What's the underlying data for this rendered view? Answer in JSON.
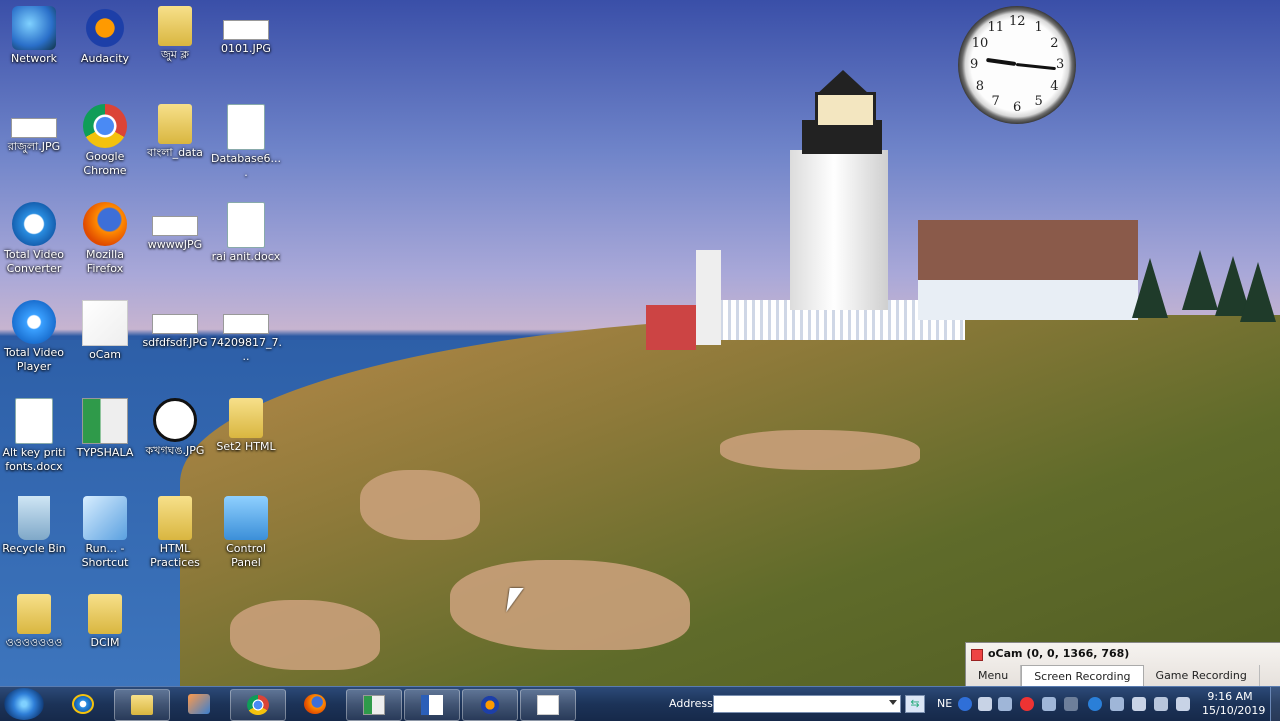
{
  "desktop_icons": [
    {
      "label": "Network",
      "icon": "network-icon"
    },
    {
      "label": "Audacity",
      "icon": "audacity-icon"
    },
    {
      "label": "জুম ক্ল",
      "icon": "folder-icon"
    },
    {
      "label": "0101.JPG",
      "icon": "jpg-file-icon"
    },
    {
      "label": "রাজুলা.JPG",
      "icon": "jpg-file-icon"
    },
    {
      "label": "Google Chrome",
      "icon": "chrome-icon"
    },
    {
      "label": "বাংলা_data",
      "icon": "folder-icon"
    },
    {
      "label": "Database6....",
      "icon": "database-file-icon"
    },
    {
      "label": "Total Video Converter",
      "icon": "video-converter-icon"
    },
    {
      "label": "Mozilla Firefox",
      "icon": "firefox-icon"
    },
    {
      "label": "wwwwJPG",
      "icon": "jpg-file-icon"
    },
    {
      "label": "rai anit.docx",
      "icon": "docx-file-icon"
    },
    {
      "label": "Total Video Player",
      "icon": "video-player-icon"
    },
    {
      "label": "oCam",
      "icon": "ocam-icon"
    },
    {
      "label": "sdfdfsdf.JPG",
      "icon": "jpg-file-icon"
    },
    {
      "label": "74209817_7...",
      "icon": "jpg-file-icon"
    },
    {
      "label": "Alt key priti fonts.docx",
      "icon": "docx-file-icon"
    },
    {
      "label": "TYPSHALA",
      "icon": "typshala-icon"
    },
    {
      "label": "কখগঘঙ.JPG",
      "icon": "copyright-image-icon"
    },
    {
      "label": "Set2 HTML",
      "icon": "folder-icon"
    },
    {
      "label": "Recycle Bin",
      "icon": "recycle-bin-icon"
    },
    {
      "label": "Run... - Shortcut",
      "icon": "run-shortcut-icon"
    },
    {
      "label": "HTML Practices",
      "icon": "html-folder-icon"
    },
    {
      "label": "Control Panel",
      "icon": "control-panel-icon"
    },
    {
      "label": "ওওওওওওও",
      "icon": "folder-icon"
    },
    {
      "label": "DCIM",
      "icon": "folder-icon"
    }
  ],
  "clock": {
    "numbers": [
      "12",
      "1",
      "2",
      "3",
      "4",
      "5",
      "6",
      "7",
      "8",
      "9",
      "10",
      "11"
    ]
  },
  "ocam": {
    "title": "oCam (0, 0, 1366, 768)",
    "tabs": [
      "Menu",
      "Screen Recording",
      "Game Recording"
    ],
    "active_tab": "Screen Recording"
  },
  "taskbar": {
    "start": "start-orb-icon",
    "pinned": [
      "internet-explorer-icon",
      "file-explorer-icon",
      "media-player-icon",
      "chrome-icon",
      "firefox-icon",
      "typshala-icon",
      "word-icon",
      "audacity-icon",
      "ocam-icon"
    ],
    "address_label": "Address",
    "address_value": "",
    "language": "NE",
    "time": "9:16 AM",
    "date": "15/10/2019"
  },
  "colors": {
    "taskbar": "#1c3358",
    "ocam_tab_active": "#ffffff"
  }
}
